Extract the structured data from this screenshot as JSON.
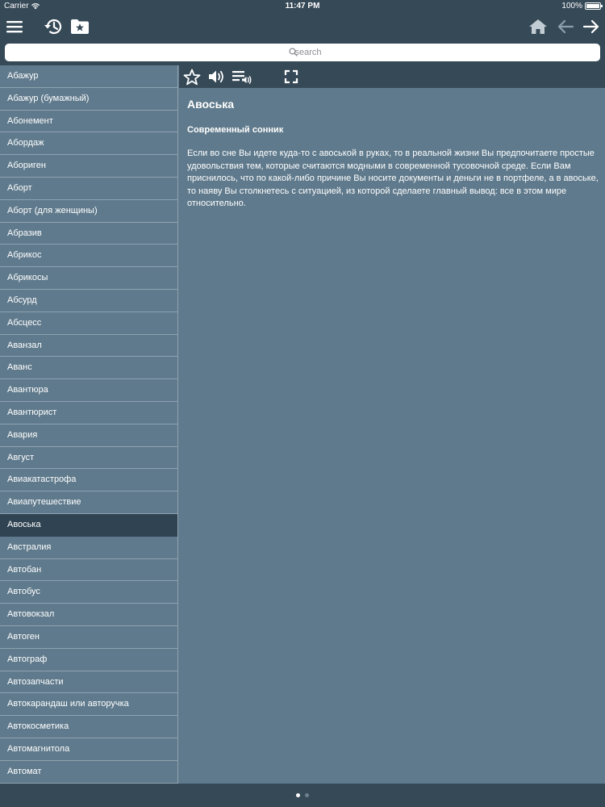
{
  "status_bar": {
    "carrier": "Carrier",
    "time": "11:47 PM",
    "battery": "100%"
  },
  "top_nav": {
    "left_icons": [
      "menu-icon",
      "history-icon",
      "favorites-folder-icon"
    ],
    "right_icons": [
      "home-icon",
      "arrow-left-icon",
      "arrow-right-icon"
    ]
  },
  "search": {
    "placeholder": "search",
    "value": ""
  },
  "word_list": {
    "selected_index": 20,
    "items": [
      "Абажур",
      "Абажур (бумажный)",
      "Абонемент",
      "Абордаж",
      "Абориген",
      "Аборт",
      "Аборт (для женщины)",
      "Абразив",
      "Абрикос",
      "Абрикосы",
      "Абсурд",
      "Абсцесс",
      "Аванзал",
      "Аванс",
      "Авантюра",
      "Авантюрист",
      "Авария",
      "Август",
      "Авиакатастрофа",
      "Авиапутешествие",
      "Авоська",
      "Австралия",
      "Автобан",
      "Автобус",
      "Автовокзал",
      "Автоген",
      "Автограф",
      "Автозапчасти",
      "Автокарандаш или авторучка",
      "Автокосметика",
      "Автомагнитола",
      "Автомат"
    ]
  },
  "toolbar": {
    "icons": [
      "star-icon",
      "speaker-icon",
      "playlist-audio-icon",
      "fullscreen-icon"
    ]
  },
  "article": {
    "title": "Авоська",
    "source": "Современный сонник",
    "body": "Если во сне Вы идете куда-то с авоськой в руках, то в реальной жизни Вы предпочитаете простые удовольствия тем, которые считаются модными в современной тусовочной среде. Если Вам приснилось, что по какой-либо причине Вы носите документы и деньги не в портфеле, а в авоське, то наяву Вы столкнетесь с ситуацией, из которой сделаете главный вывод: все в этом мире относительно."
  },
  "pager": {
    "pages": 2,
    "current": 1
  },
  "colors": {
    "bar": "#364957",
    "panel": "#5f7a8c",
    "selected": "#2f4352"
  }
}
